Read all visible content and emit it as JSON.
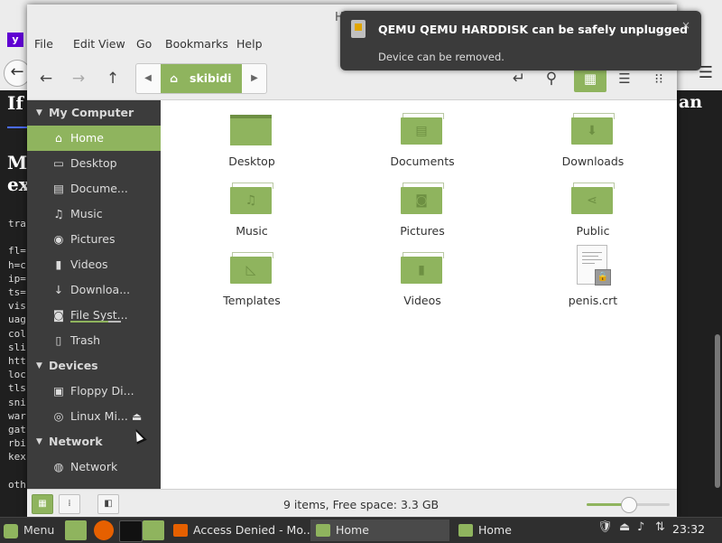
{
  "background_browser": {
    "heading1": "If",
    "heading1_right": "an",
    "heading2_line1": "M",
    "heading2_line2": "ex",
    "code_lines": [
      "tra",
      "",
      "fl=",
      "h=c",
      "ip=",
      "ts=",
      "vis",
      "uag",
      "col",
      "sli",
      "htt",
      "loc",
      "tls",
      "sni",
      "war",
      "gat",
      "rbi",
      "kex",
      "",
      "oth"
    ]
  },
  "window": {
    "title": "H"
  },
  "menubar": [
    "File",
    "Edit",
    "View",
    "Go",
    "Bookmarks",
    "Help"
  ],
  "toolbar": {
    "back_icon": "←",
    "forward_icon": "→",
    "up_icon": "↑",
    "path_left_arrow": "◀",
    "path_right_arrow": "▶",
    "current_folder": "skibidi",
    "home_icon": "⌂",
    "toggle_location_icon": "↵",
    "search_icon": "⚲",
    "icon_view_icon": "▦",
    "list_view_icon": "☰",
    "compact_view_icon": "⁝⁝"
  },
  "sidebar": {
    "sections": [
      {
        "title": "My Computer",
        "items": [
          {
            "label": "Home",
            "icon": "⌂",
            "active": true
          },
          {
            "label": "Desktop",
            "icon": "▭"
          },
          {
            "label": "Docume...",
            "icon": "▤"
          },
          {
            "label": "Music",
            "icon": "♫"
          },
          {
            "label": "Pictures",
            "icon": "◉"
          },
          {
            "label": "Videos",
            "icon": "▮"
          },
          {
            "label": "Downloa...",
            "icon": "↓"
          },
          {
            "label": "File Syst...",
            "icon": "◙"
          },
          {
            "label": "Trash",
            "icon": "▯"
          }
        ]
      },
      {
        "title": "Devices",
        "items": [
          {
            "label": "Floppy Di...",
            "icon": "▣"
          },
          {
            "label": "Linux Mi...",
            "icon": "◎",
            "eject": "⏏"
          }
        ]
      },
      {
        "title": "Network",
        "items": [
          {
            "label": "Network",
            "icon": "◍"
          }
        ]
      }
    ]
  },
  "files": [
    {
      "name": "Desktop",
      "type": "desktop"
    },
    {
      "name": "Documents",
      "type": "folder",
      "emblem": "▤"
    },
    {
      "name": "Downloads",
      "type": "folder",
      "emblem": "⬇"
    },
    {
      "name": "Music",
      "type": "folder",
      "emblem": "♫"
    },
    {
      "name": "Pictures",
      "type": "folder",
      "emblem": "◙"
    },
    {
      "name": "Public",
      "type": "folder",
      "emblem": "⋖"
    },
    {
      "name": "Templates",
      "type": "folder",
      "emblem": "◺"
    },
    {
      "name": "Videos",
      "type": "folder",
      "emblem": "▮"
    },
    {
      "name": "penis.crt",
      "type": "certificate"
    }
  ],
  "statusbar": {
    "text": "9 items, Free space: 3.3 GB",
    "zoom_fraction": 0.5
  },
  "notification": {
    "title": "QEMU QEMU HARDDISK can be safely unplugged",
    "body": "Device can be removed.",
    "close": "×"
  },
  "taskbar": {
    "menu_label": "Menu",
    "tasks": [
      {
        "label": "Access Denied - Mo...",
        "active": false,
        "icon_color": "#e66000"
      },
      {
        "label": "Home",
        "active": true,
        "icon_color": "#8fb45e"
      },
      {
        "label": "Home",
        "active": false,
        "icon_color": "#8fb45e"
      }
    ],
    "clock": "23:32"
  },
  "colors": {
    "accent": "#8fb45e",
    "sidebar_bg": "#3c3c3c",
    "notification_bg": "#3b3b3b"
  }
}
